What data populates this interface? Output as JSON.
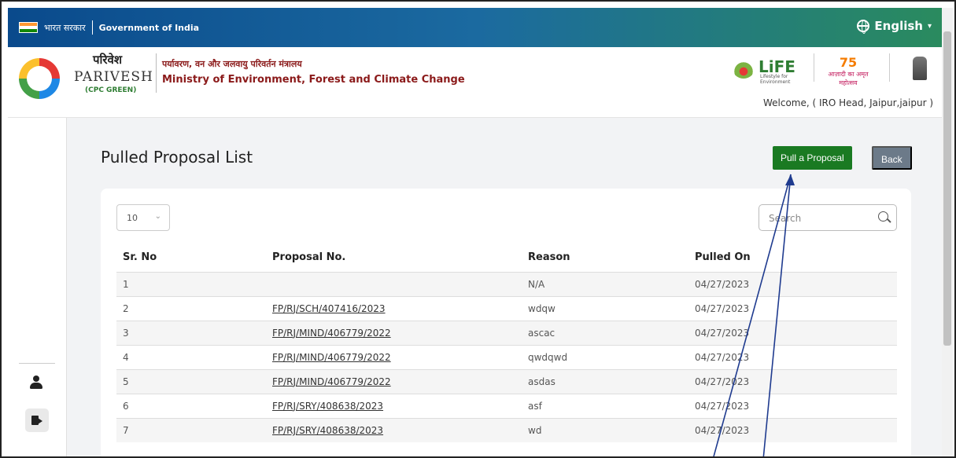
{
  "govbar": {
    "hindi_label": "भारत सरकार",
    "gov_label": "Government of India",
    "language": "English"
  },
  "header": {
    "parivesh_hindi": "परिवेश",
    "parivesh_en": "PARIVESH",
    "cpc": "(CPC GREEN)",
    "ministry_hindi": "पर्यावरण, वन और जलवायु परिवर्तन मंत्रालय",
    "ministry_en": "Ministry of Environment, Forest and Climate Change",
    "life_text": "LiFE",
    "life_sub": "Lifestyle for Environment",
    "azadi_num": "75",
    "azadi_text": "आज़ादी का अमृत महोत्सव",
    "welcome": "Welcome, ( IRO Head,  Jaipur,jaipur )"
  },
  "page": {
    "title": "Pulled Proposal List",
    "pull_button": "Pull a Proposal",
    "back_button": "Back",
    "page_size": "10",
    "search_placeholder": "Search"
  },
  "table": {
    "headers": [
      "Sr. No",
      "Proposal No.",
      "Reason",
      "Pulled On"
    ],
    "rows": [
      {
        "sr": "1",
        "proposal": "",
        "reason": "N/A",
        "pulled_on": "04/27/2023"
      },
      {
        "sr": "2",
        "proposal": "FP/RJ/SCH/407416/2023",
        "reason": "wdqw",
        "pulled_on": "04/27/2023"
      },
      {
        "sr": "3",
        "proposal": "FP/RJ/MIND/406779/2022",
        "reason": "ascac",
        "pulled_on": "04/27/2023"
      },
      {
        "sr": "4",
        "proposal": "FP/RJ/MIND/406779/2022",
        "reason": "qwdqwd",
        "pulled_on": "04/27/2023"
      },
      {
        "sr": "5",
        "proposal": "FP/RJ/MIND/406779/2022",
        "reason": "asdas",
        "pulled_on": "04/27/2023"
      },
      {
        "sr": "6",
        "proposal": "FP/RJ/SRY/408638/2023",
        "reason": "asf",
        "pulled_on": "04/27/2023"
      },
      {
        "sr": "7",
        "proposal": "FP/RJ/SRY/408638/2023",
        "reason": "wd",
        "pulled_on": "04/27/2023"
      }
    ]
  }
}
